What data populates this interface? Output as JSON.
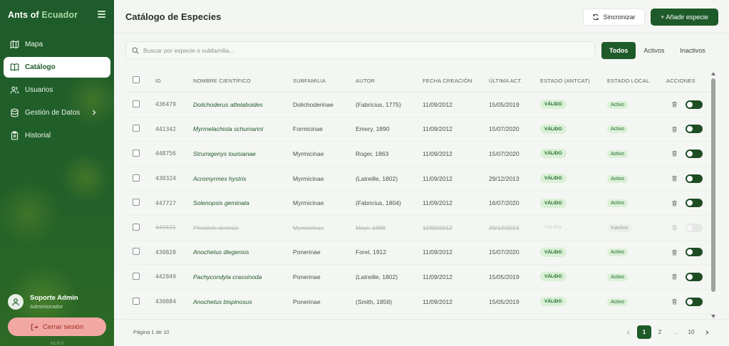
{
  "sidebar": {
    "brand_part1": "Ants of",
    "brand_part2": "Ecuador",
    "items": [
      {
        "label": "Mapa",
        "icon": "map-icon"
      },
      {
        "label": "Catálogo",
        "icon": "book-icon"
      },
      {
        "label": "Usuarios",
        "icon": "users-icon"
      },
      {
        "label": "Gestión de Datos",
        "icon": "database-icon"
      },
      {
        "label": "Historial",
        "icon": "clipboard-icon"
      }
    ],
    "user_name": "Soporte Admin",
    "user_role": "Administrador",
    "logout_label": "Cerrar sesión",
    "version": "v1.0.0"
  },
  "header": {
    "title": "Catálogo de Especies",
    "sync_label": "Sincronizar",
    "add_label": "+ Añadir especie"
  },
  "search": {
    "placeholder": "Buscar por especie o subfamilia..."
  },
  "filters": [
    "Todos",
    "Activos",
    "Inactivos"
  ],
  "table": {
    "columns": [
      "ID",
      "Nombre científico",
      "Subfamilia",
      "Autor",
      "Fecha creación",
      "Última act.",
      "Estado (AntCat)",
      "Estado local",
      "Acciones"
    ],
    "rows": [
      {
        "id": "436479",
        "name": "Dolichoderus attelaboides",
        "subfamily": "Dolichoderinae",
        "author": "(Fabricius, 1775)",
        "created": "11/09/2012",
        "updated": "15/05/2019",
        "antcat": "VÁLIDO",
        "local": "Activo",
        "active": true
      },
      {
        "id": "441342",
        "name": "Myrmelachista schumanni",
        "subfamily": "Formicinae",
        "author": "Emery, 1890",
        "created": "11/09/2012",
        "updated": "15/07/2020",
        "antcat": "VÁLIDO",
        "local": "Activo",
        "active": true
      },
      {
        "id": "448756",
        "name": "Strumigenys louisianae",
        "subfamily": "Myrmicinae",
        "author": "Roger, 1863",
        "created": "11/09/2012",
        "updated": "15/07/2020",
        "antcat": "VÁLIDO",
        "local": "Activo",
        "active": true
      },
      {
        "id": "430324",
        "name": "Acromyrmex hystrix",
        "subfamily": "Myrmicinae",
        "author": "(Latreille, 1802)",
        "created": "11/09/2012",
        "updated": "29/12/2013",
        "antcat": "VÁLIDO",
        "local": "Activo",
        "active": true
      },
      {
        "id": "447727",
        "name": "Solenopsis geminata",
        "subfamily": "Myrmicinae",
        "author": "(Fabricius, 1804)",
        "created": "11/09/2012",
        "updated": "16/07/2020",
        "antcat": "VÁLIDO",
        "local": "Activo",
        "active": true
      },
      {
        "id": "443631",
        "name": "Pheidole dentata",
        "subfamily": "Myrmicinae",
        "author": "Mayr, 1886",
        "created": "11/09/2012",
        "updated": "29/12/2013",
        "antcat": "VÁLIDO",
        "local": "Inactivo",
        "active": false
      },
      {
        "id": "430820",
        "name": "Anochetus diegensis",
        "subfamily": "Ponerinae",
        "author": "Forel, 1912",
        "created": "11/09/2012",
        "updated": "15/07/2020",
        "antcat": "VÁLIDO",
        "local": "Activo",
        "active": true
      },
      {
        "id": "442849",
        "name": "Pachycondyla crassinoda",
        "subfamily": "Ponerinae",
        "author": "(Latreille, 1802)",
        "created": "11/09/2012",
        "updated": "15/05/2019",
        "antcat": "VÁLIDO",
        "local": "Activo",
        "active": true
      },
      {
        "id": "430884",
        "name": "Anochetus bispinosus",
        "subfamily": "Ponerinae",
        "author": "(Smith, 1858)",
        "created": "11/09/2012",
        "updated": "15/05/2019",
        "antcat": "VÁLIDO",
        "local": "Activo",
        "active": true
      }
    ]
  },
  "pagination": {
    "info": "Página 1 de 10",
    "pages": [
      "1",
      "2",
      "...",
      "10"
    ],
    "current": "1"
  },
  "colors": {
    "brand_green": "#1e5a2a",
    "valid_badge_bg": "#d9f0d5",
    "logout_bg": "#f1a8a3"
  }
}
